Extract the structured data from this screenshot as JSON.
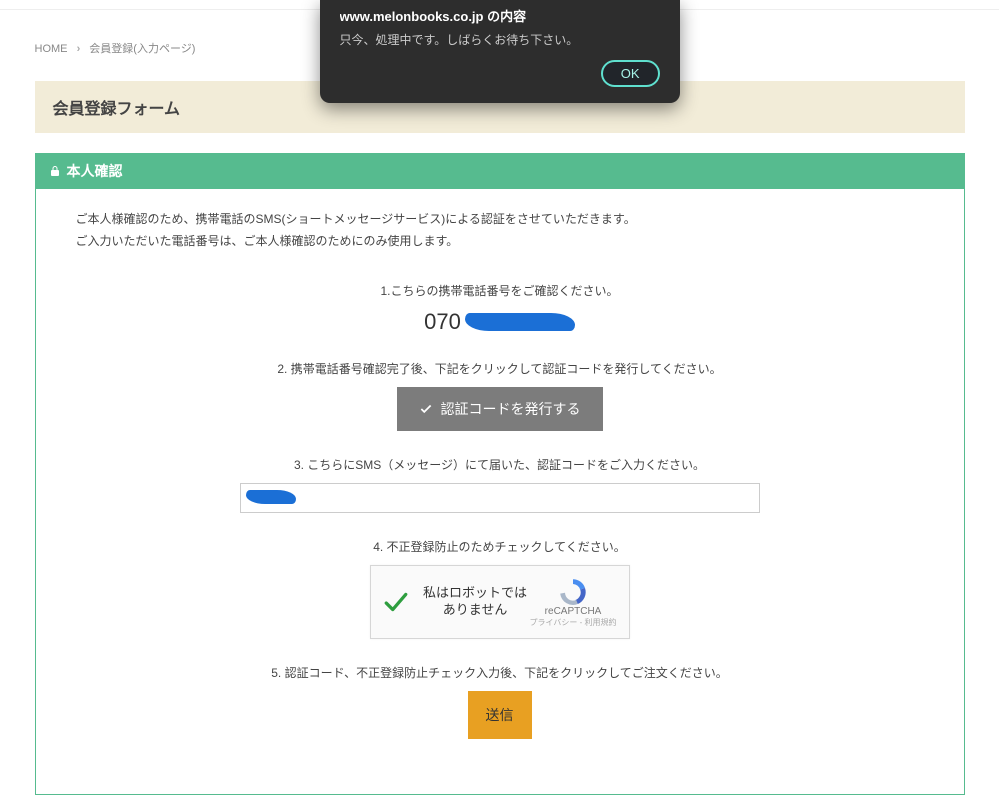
{
  "alert": {
    "title": "www.melonbooks.co.jp の内容",
    "body": "只今、処理中です。しばらくお待ち下さい。",
    "ok": "OK"
  },
  "breadcrumb": {
    "home": "HOME",
    "current": "会員登録(入力ページ)"
  },
  "page_title": "会員登録フォーム",
  "section": {
    "title": "本人確認",
    "intro_line1": "ご本人様確認のため、携帯電話のSMS(ショートメッセージサービス)による認証をさせていただきます。",
    "intro_line2": "ご入力いただいた電話番号は、ご本人様確認のためにのみ使用します。"
  },
  "steps": {
    "s1_label": "1.こちらの携帯電話番号をご確認ください。",
    "s1_phone_visible": "070",
    "s2_label": "2. 携帯電話番号確認完了後、下記をクリックして認証コードを発行してください。",
    "s2_button": "認証コードを発行する",
    "s3_label": "3. こちらにSMS（メッセージ）にて届いた、認証コードをご入力ください。",
    "s4_label": "4. 不正登録防止のためチェックしてください。",
    "s5_label": "5. 認証コード、不正登録防止チェック入力後、下記をクリックしてご注文ください。",
    "submit": "送信"
  },
  "recaptcha": {
    "label": "私はロボットではありません",
    "brand": "reCAPTCHA",
    "terms": "プライバシー - 利用規約"
  }
}
